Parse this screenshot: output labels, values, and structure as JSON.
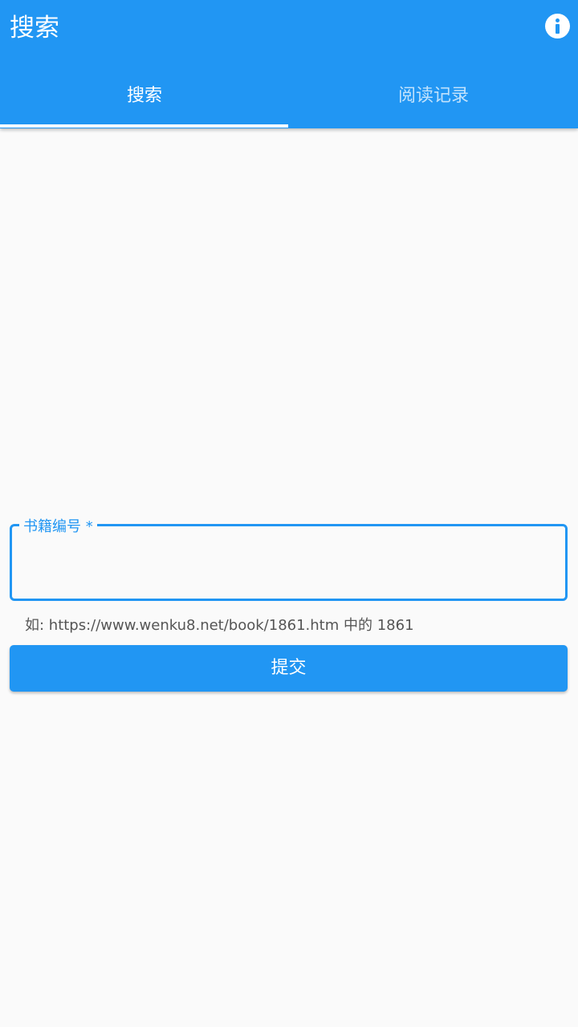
{
  "appbar": {
    "title": "搜索",
    "info_icon": "info-icon",
    "accent_color": "#2196f3"
  },
  "tabs": [
    {
      "label": "搜索",
      "selected": true
    },
    {
      "label": "阅读记录",
      "selected": false
    }
  ],
  "form": {
    "field_label": "书籍编号 *",
    "field_value": "",
    "hint": "如: https://www.wenku8.net/book/1861.htm 中的 1861",
    "submit_label": "提交"
  }
}
